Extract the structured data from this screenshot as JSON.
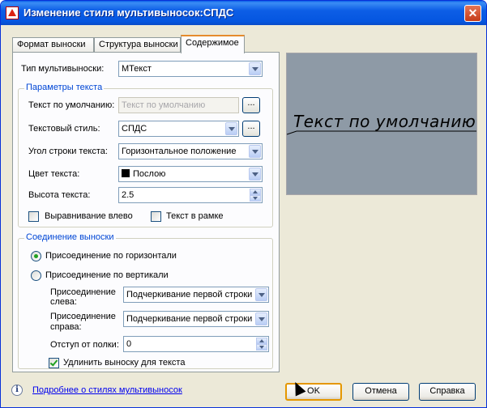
{
  "window": {
    "title": "Изменение стиля мультивыносок:СПДС",
    "close_glyph": "✕"
  },
  "tabs": [
    {
      "label": "Формат выноски",
      "active": false
    },
    {
      "label": "Структура выноски",
      "active": false
    },
    {
      "label": "Содержимое",
      "active": true
    }
  ],
  "content": {
    "multileader_type": {
      "label": "Тип мультивыноски:",
      "value": "MТекст"
    },
    "text_params": {
      "title": "Параметры текста",
      "default_text": {
        "label": "Текст по умолчанию:",
        "value": "Текст по умолчанию",
        "browse": "..."
      },
      "text_style": {
        "label": "Текстовый стиль:",
        "value": "СПДС",
        "browse": "..."
      },
      "text_angle": {
        "label": "Угол строки текста:",
        "value": "Горизонтальное положение"
      },
      "text_color": {
        "label": "Цвет текста:",
        "value": "Послою",
        "swatch_color": "#000000"
      },
      "text_height": {
        "label": "Высота текста:",
        "value": "2.5"
      },
      "left_justify": {
        "label": "Выравнивание влево",
        "checked": false
      },
      "frame_text": {
        "label": "Текст в рамке",
        "checked": false
      }
    },
    "leader_connection": {
      "title": "Соединение выноски",
      "horizontal": {
        "label": "Присоединение по горизонтали",
        "checked": true
      },
      "vertical": {
        "label": "Присоединение по вертикали",
        "checked": false
      },
      "attach_left": {
        "label_line1": "Присоединение",
        "label_line2": "слева:",
        "value": "Подчеркивание первой строки"
      },
      "attach_right": {
        "label_line1": "Присоединение",
        "label_line2": "справа:",
        "value": "Подчеркивание первой строки"
      },
      "landing_gap": {
        "label": "Отступ от полки:",
        "value": "0"
      },
      "extend_leader": {
        "label": "Удлинить выноску для текста",
        "checked": true
      }
    }
  },
  "preview": {
    "text": "Текст по умолчанию",
    "background": "#8e9aa6"
  },
  "footer": {
    "help_link": "Подробнее о стилях мультивыносок",
    "ok": "OK",
    "cancel": "Отмена",
    "help": "Справка"
  }
}
